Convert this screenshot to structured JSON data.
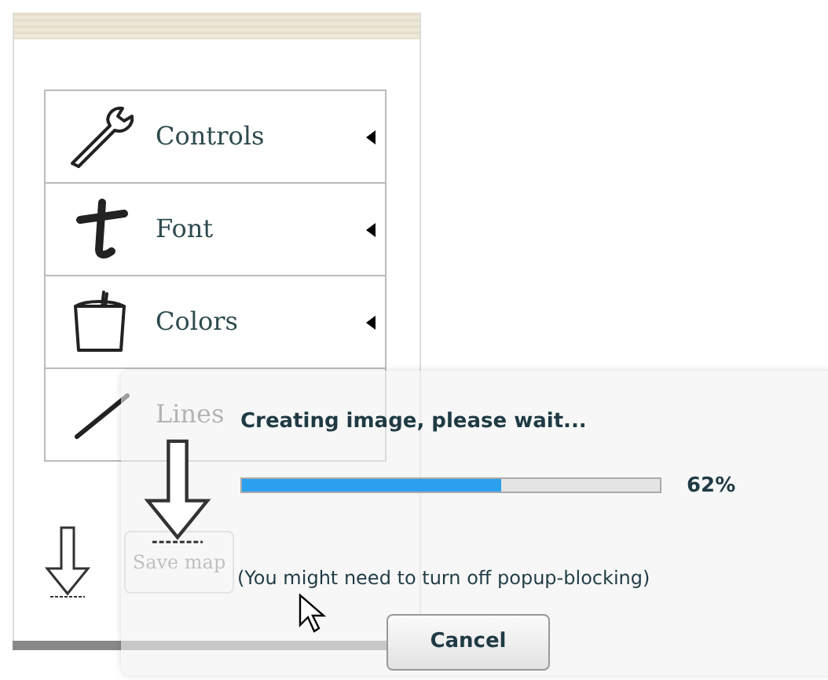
{
  "menu": {
    "items": [
      {
        "label": "Controls",
        "kind": "wrench",
        "expanded": false
      },
      {
        "label": "Font",
        "kind": "font",
        "expanded": false
      },
      {
        "label": "Colors",
        "kind": "bucket",
        "expanded": false
      },
      {
        "label": "Lines",
        "kind": "line",
        "expanded": false
      }
    ]
  },
  "save_button": {
    "label": "Save map",
    "disabled": true
  },
  "dialog": {
    "title": "Creating image, please wait...",
    "progress": {
      "level": 0.62,
      "reading": "62%"
    },
    "note": "(You might need to turn off popup-blocking)",
    "cancel": "Cancel"
  }
}
